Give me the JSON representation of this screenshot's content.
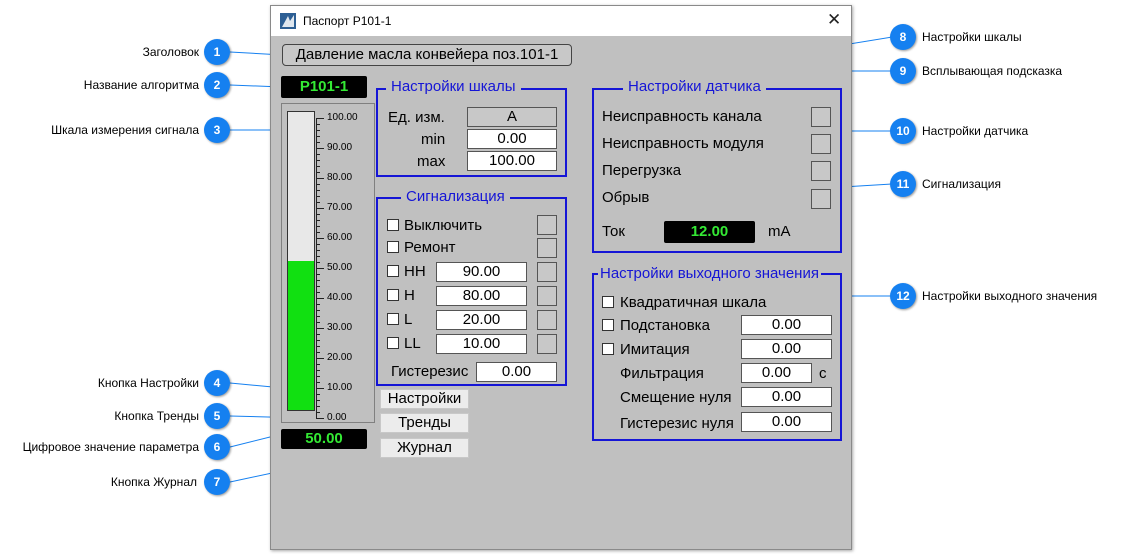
{
  "window": {
    "title": "Паспорт P101-1",
    "close_glyph": "✕"
  },
  "header": {
    "param_title": "Давление масла конвейера поз.101-1",
    "algorithm_name": "P101-1"
  },
  "bar": {
    "ticks": [
      "100.00",
      "90.00",
      "80.00",
      "70.00",
      "60.00",
      "50.00",
      "40.00",
      "30.00",
      "20.00",
      "10.00",
      "0.00"
    ],
    "level_fraction": 0.5,
    "fill_color": "#11e011",
    "digital_value": "50.00"
  },
  "buttons": {
    "settings": "Настройки",
    "trends": "Тренды",
    "journal": "Журнал"
  },
  "scale_settings": {
    "title": "Настройки шкалы",
    "unit_label": "Ед. изм.",
    "unit_value": "A",
    "min_label": "min",
    "min_value": "0.00",
    "max_label": "max",
    "max_value": "100.00"
  },
  "alarms": {
    "title": "Сигнализация",
    "disable_label": "Выключить",
    "repair_label": "Ремонт",
    "levels": [
      {
        "label": "HH",
        "value": "90.00"
      },
      {
        "label": "H",
        "value": "80.00"
      },
      {
        "label": "L",
        "value": "20.00"
      },
      {
        "label": "LL",
        "value": "10.00"
      }
    ],
    "hysteresis_label": "Гистерезис",
    "hysteresis_value": "0.00"
  },
  "sensor": {
    "title": "Настройки датчика",
    "faults": [
      "Неисправность канала",
      "Неисправность модуля",
      "Перегрузка",
      "Обрыв"
    ],
    "current_label": "Ток",
    "current_value": "12.00",
    "current_unit": "mA"
  },
  "output": {
    "title": "Настройки выходного значения",
    "square_scale_label": "Квадратичная шкала",
    "substitution_label": "Подстановка",
    "substitution_value": "0.00",
    "imitation_label": "Имитация",
    "imitation_value": "0.00",
    "filtration_label": "Фильтрация",
    "filtration_value": "0.00",
    "filtration_unit": "с",
    "zero_offset_label": "Смещение нуля",
    "zero_offset_value": "0.00",
    "zero_hysteresis_label": "Гистерезис нуля",
    "zero_hysteresis_value": "0.00"
  },
  "callouts": {
    "c1": {
      "num": "1",
      "text": "Заголовок"
    },
    "c2": {
      "num": "2",
      "text": "Название алгоритма"
    },
    "c3": {
      "num": "3",
      "text": "Шкала измерения сигнала"
    },
    "c4": {
      "num": "4",
      "text": "Кнопка Настройки"
    },
    "c5": {
      "num": "5",
      "text": "Кнопка Тренды"
    },
    "c6": {
      "num": "6",
      "text": "Цифровое значение параметра"
    },
    "c7": {
      "num": "7",
      "text": "Кнопка Журнал"
    },
    "c8": {
      "num": "8",
      "text": "Настройки шкалы"
    },
    "c9": {
      "num": "9",
      "text": "Всплывающая подсказка"
    },
    "c10": {
      "num": "10",
      "text": "Настройки датчика"
    },
    "c11": {
      "num": "11",
      "text": "Сигнализация"
    },
    "c12": {
      "num": "12",
      "text": "Настройки выходного значения"
    }
  },
  "colors": {
    "group_border": "#1515d6",
    "badge": "#1580f0",
    "digit_text": "#34e934",
    "window_bg": "#c0c0c0"
  }
}
